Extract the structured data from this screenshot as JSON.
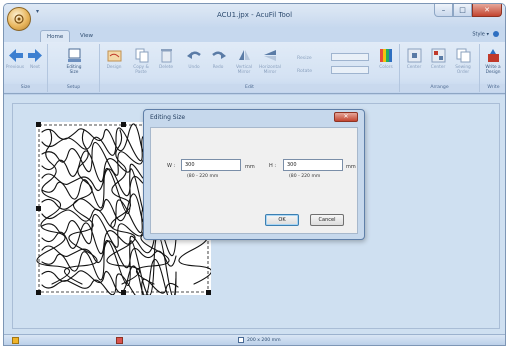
{
  "app": {
    "title": "ACU1.jpx - AcuFil Tool",
    "quick_access": "▾",
    "controls": {
      "minimize": "–",
      "maximize": "□",
      "close": "✕"
    }
  },
  "tabs": [
    {
      "label": "Home",
      "active": true
    },
    {
      "label": "View",
      "active": false
    }
  ],
  "style_menu": "Style ▾",
  "ribbon": {
    "groups": {
      "size": {
        "label": "Size",
        "previous": "Previous",
        "next": "Next"
      },
      "setup": {
        "label": "Setup",
        "editing_size": "Editing Size"
      },
      "edit": {
        "label": "Edit",
        "design": "Design",
        "copy_paste": "Copy & Paste",
        "delete": "Delete",
        "undo": "Undo",
        "redo": "Redo",
        "vertical_mirror": "Vertical Mirror",
        "horizontal_mirror": "Horizontal Mirror",
        "resize": "Resize",
        "rotate": "Rotate",
        "colors": "Colors"
      },
      "arrange": {
        "label": "Arrange",
        "center": "Center",
        "center2": "Center",
        "sewing_order": "Sewing Order"
      },
      "write": {
        "label": "Write",
        "write_design": "Write a Design"
      }
    }
  },
  "dialog": {
    "title": "Editing Size",
    "close": "✕",
    "width_label": "W :",
    "width_value": "300",
    "width_unit": "mm",
    "width_range": "(80 - 220 mm",
    "height_label": "H :",
    "height_value": "300",
    "height_unit": "mm",
    "height_range": "(80 - 220 mm",
    "ok": "OK",
    "cancel": "Cancel"
  },
  "status": {
    "size_text": "200 x 200 mm"
  },
  "colors": {
    "accent": "#2e6fc1",
    "close_red": "#c34530",
    "ribbon": "#d4e2f3",
    "workspace": "#cfe0f1"
  }
}
